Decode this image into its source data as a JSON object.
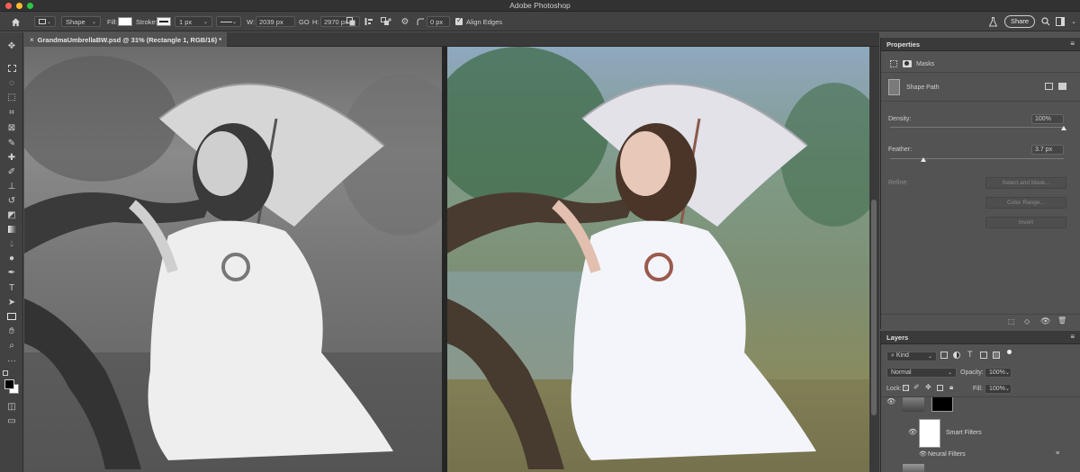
{
  "app": {
    "title": "Adobe Photoshop"
  },
  "window_controls": {
    "close_color": "#fe5f57",
    "minimize_color": "#febc2e",
    "zoom_color": "#28c840"
  },
  "options_bar": {
    "home_icon": "home-icon",
    "shape_mode": "Shape",
    "fill_label": "Fill:",
    "stroke_label": "Stroke:",
    "stroke_width": "1 px",
    "width_label": "W:",
    "width_value": "2039 px",
    "link_label": "GO",
    "height_label": "H:",
    "height_value": "2970 px",
    "corner_radius": "0 px",
    "align_edges_label": "Align Edges",
    "align_edges_checked": true,
    "share_label": "Share"
  },
  "document": {
    "tab_title": "GrandmaUmbrellaBW.psd @ 31% (Rectangle 1, RGB/16) *"
  },
  "properties": {
    "title": "Properties",
    "masks_label": "Masks",
    "shape_path_label": "Shape Path",
    "density_label": "Density:",
    "density_value": "100%",
    "density_fraction": 1.0,
    "feather_label": "Feather:",
    "feather_value": "3.7 px",
    "feather_fraction": 0.19,
    "refine_label": "Refine:",
    "select_and_mask": "Select and Mask...",
    "color_range": "Color Range...",
    "invert": "Invert"
  },
  "layers": {
    "title": "Layers",
    "kind_filter": "Kind",
    "blend_mode": "Normal",
    "opacity_label": "Opacity:",
    "opacity_value": "100%",
    "lock_label": "Lock:",
    "fill_label": "Fill:",
    "fill_value": "100%",
    "smart_filters_label": "Smart Filters",
    "neural_filters_label": "Neural Filters"
  }
}
